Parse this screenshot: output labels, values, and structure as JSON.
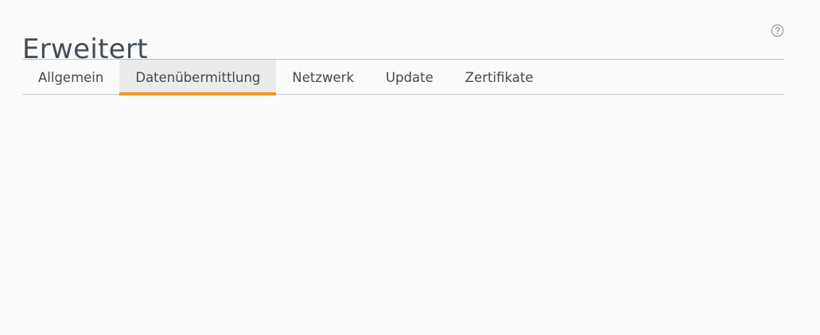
{
  "page": {
    "title": "Erweitert",
    "help_icon": "help-circle-icon"
  },
  "tabs": [
    {
      "label": "Allgemein",
      "active": false
    },
    {
      "label": "Datenübermittlung",
      "active": true
    },
    {
      "label": "Netzwerk",
      "active": false
    },
    {
      "label": "Update",
      "active": false
    },
    {
      "label": "Zertifikate",
      "active": false
    }
  ],
  "colors": {
    "accent": "#f09a23",
    "active_tab_bg": "#ebebeb",
    "text": "#424950",
    "background": "#fafafa"
  }
}
